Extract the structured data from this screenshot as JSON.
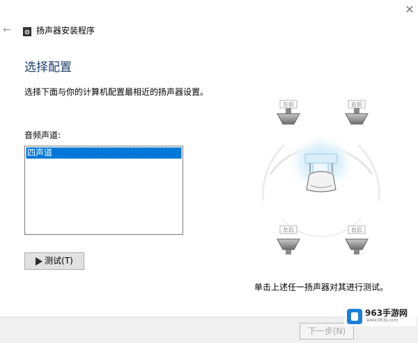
{
  "window": {
    "title": "扬声器安装程序",
    "back_icon": "back-arrow-icon",
    "app_icon": "speaker-setup-icon",
    "close_icon": "close-icon"
  },
  "page": {
    "heading": "选择配置",
    "instructions": "选择下面与你的计算机配置最相近的扬声器设置。",
    "channels_label": "音频声道:",
    "channels": [
      "四声道"
    ],
    "selected_channel": "四声道",
    "test_button_label": "测试(T)",
    "hint": "单击上述任一扬声器对其进行测试。"
  },
  "speakers": {
    "front_left": "左前",
    "front_right": "右前",
    "rear_left": "左后",
    "rear_right": "右后"
  },
  "footer": {
    "next_button_label": "下一步(N)"
  },
  "watermark": {
    "title": "963手游网",
    "url": "www.963s.com"
  },
  "colors": {
    "heading": "#1b3f6e",
    "selection": "#0078d7",
    "footer_bg": "#f0f0f0"
  }
}
